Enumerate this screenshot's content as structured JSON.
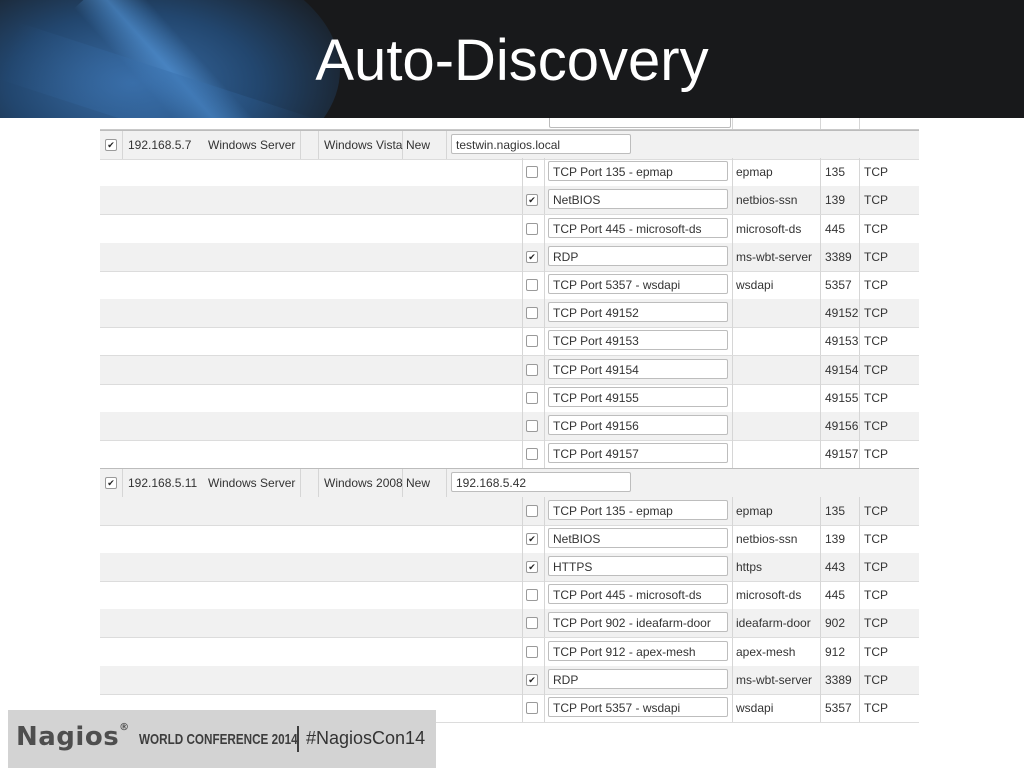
{
  "slide": {
    "title": "Auto-Discovery"
  },
  "footer": {
    "brand": "Nagios",
    "registered_mark": "®",
    "conference": "WORLD CONFERENCE 2014",
    "hashtag": "#NagiosCon14"
  },
  "hosts": [
    {
      "selected": true,
      "ip": "192.168.5.7",
      "type": "Windows Server",
      "os": "Windows Vista",
      "status": "New",
      "hostname": "testwin.nagios.local",
      "services": [
        {
          "checked": false,
          "name": "TCP Port 135 - epmap",
          "service": "epmap",
          "port": "135",
          "protocol": "TCP"
        },
        {
          "checked": true,
          "name": "NetBIOS",
          "service": "netbios-ssn",
          "port": "139",
          "protocol": "TCP"
        },
        {
          "checked": false,
          "name": "TCP Port 445 - microsoft-ds",
          "service": "microsoft-ds",
          "port": "445",
          "protocol": "TCP"
        },
        {
          "checked": true,
          "name": "RDP",
          "service": "ms-wbt-server",
          "port": "3389",
          "protocol": "TCP"
        },
        {
          "checked": false,
          "name": "TCP Port 5357 - wsdapi",
          "service": "wsdapi",
          "port": "5357",
          "protocol": "TCP"
        },
        {
          "checked": false,
          "name": "TCP Port 49152",
          "service": "",
          "port": "49152",
          "protocol": "TCP"
        },
        {
          "checked": false,
          "name": "TCP Port 49153",
          "service": "",
          "port": "49153",
          "protocol": "TCP"
        },
        {
          "checked": false,
          "name": "TCP Port 49154",
          "service": "",
          "port": "49154",
          "protocol": "TCP"
        },
        {
          "checked": false,
          "name": "TCP Port 49155",
          "service": "",
          "port": "49155",
          "protocol": "TCP"
        },
        {
          "checked": false,
          "name": "TCP Port 49156",
          "service": "",
          "port": "49156",
          "protocol": "TCP"
        },
        {
          "checked": false,
          "name": "TCP Port 49157",
          "service": "",
          "port": "49157",
          "protocol": "TCP"
        }
      ]
    },
    {
      "selected": true,
      "ip": "192.168.5.11",
      "type": "Windows Server",
      "os": "Windows 2008",
      "status": "New",
      "hostname": "192.168.5.42",
      "services": [
        {
          "checked": false,
          "name": "TCP Port 135 - epmap",
          "service": "epmap",
          "port": "135",
          "protocol": "TCP"
        },
        {
          "checked": true,
          "name": "NetBIOS",
          "service": "netbios-ssn",
          "port": "139",
          "protocol": "TCP"
        },
        {
          "checked": true,
          "name": "HTTPS",
          "service": "https",
          "port": "443",
          "protocol": "TCP"
        },
        {
          "checked": false,
          "name": "TCP Port 445 - microsoft-ds",
          "service": "microsoft-ds",
          "port": "445",
          "protocol": "TCP"
        },
        {
          "checked": false,
          "name": "TCP Port 902 - ideafarm-door",
          "service": "ideafarm-door",
          "port": "902",
          "protocol": "TCP"
        },
        {
          "checked": false,
          "name": "TCP Port 912 - apex-mesh",
          "service": "apex-mesh",
          "port": "912",
          "protocol": "TCP"
        },
        {
          "checked": true,
          "name": "RDP",
          "service": "ms-wbt-server",
          "port": "3389",
          "protocol": "TCP"
        },
        {
          "checked": false,
          "name": "TCP Port 5357 - wsdapi",
          "service": "wsdapi",
          "port": "5357",
          "protocol": "TCP"
        }
      ]
    }
  ]
}
